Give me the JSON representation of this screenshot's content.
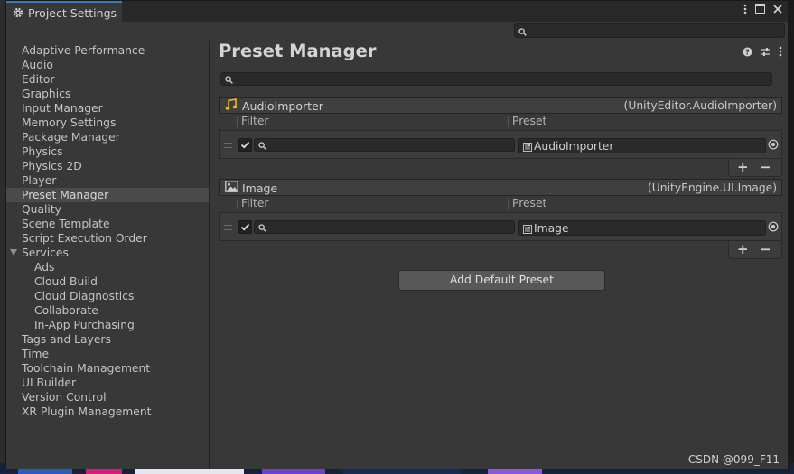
{
  "window": {
    "tab_title": "Project Settings",
    "controls": [
      "more-icon",
      "maximize-icon",
      "close-icon"
    ]
  },
  "toolbar": {
    "search_placeholder": ""
  },
  "sidebar": {
    "items": [
      {
        "label": "Adaptive Performance"
      },
      {
        "label": "Audio"
      },
      {
        "label": "Editor"
      },
      {
        "label": "Graphics"
      },
      {
        "label": "Input Manager"
      },
      {
        "label": "Memory Settings"
      },
      {
        "label": "Package Manager"
      },
      {
        "label": "Physics"
      },
      {
        "label": "Physics 2D"
      },
      {
        "label": "Player"
      },
      {
        "label": "Preset Manager",
        "selected": true
      },
      {
        "label": "Quality"
      },
      {
        "label": "Scene Template"
      },
      {
        "label": "Script Execution Order"
      },
      {
        "label": "Services",
        "expanded": true
      },
      {
        "label": "Ads",
        "child": true
      },
      {
        "label": "Cloud Build",
        "child": true
      },
      {
        "label": "Cloud Diagnostics",
        "child": true
      },
      {
        "label": "Collaborate",
        "child": true
      },
      {
        "label": "In-App Purchasing",
        "child": true
      },
      {
        "label": "Tags and Layers"
      },
      {
        "label": "Time"
      },
      {
        "label": "Toolchain Management"
      },
      {
        "label": "UI Builder"
      },
      {
        "label": "Version Control"
      },
      {
        "label": "XR Plugin Management"
      }
    ]
  },
  "main": {
    "title": "Preset Manager",
    "search_placeholder": "",
    "filter_header": "Filter",
    "preset_header": "Preset",
    "add_default_label": "Add Default Preset",
    "plus_label": "+",
    "minus_label": "−",
    "presets": [
      {
        "name": "AudioImporter",
        "type": "(UnityEditor.AudioImporter)",
        "icon": "audio-note-icon",
        "enabled": true,
        "filter": "",
        "preset_value": "AudioImporter"
      },
      {
        "name": "Image",
        "type": "(UnityEngine.UI.Image)",
        "icon": "image-icon",
        "enabled": true,
        "filter": "",
        "preset_value": "Image"
      }
    ]
  },
  "watermark": "CSDN @099_F11",
  "colors": {
    "accent": "#3a79bb",
    "selected_bg": "#4a4a4a",
    "panel_bg": "#383838",
    "audio_icon": "#e8b923"
  }
}
